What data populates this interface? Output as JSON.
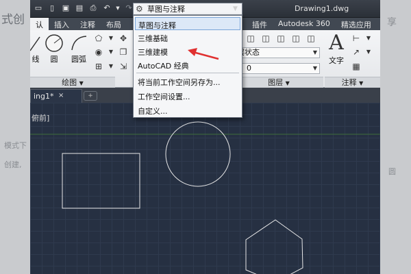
{
  "background_page": {
    "title_fragment": "式创",
    "line1_fragment": "模式下",
    "line2_fragment": "创建,",
    "right1_fragment": "享",
    "right2_fragment": "圆"
  },
  "titlebar": {
    "workspace_current": "草图与注释",
    "document_title": "Drawing1.dwg"
  },
  "ribbon_tabs": [
    {
      "label": "认"
    },
    {
      "label": "插入"
    },
    {
      "label": "注释"
    },
    {
      "label": "布局"
    },
    {
      "label": "插件"
    },
    {
      "label": "Autodesk 360"
    },
    {
      "label": "精选应用"
    }
  ],
  "ribbon": {
    "tool_line": "线",
    "tool_circle": "圆",
    "tool_arc": "圆弧",
    "panel_draw": "绘图",
    "layer_state": "层状态",
    "layer_current": "0",
    "panel_layers": "图层",
    "tool_text": "文字",
    "panel_annotation": "注释"
  },
  "file_tab": {
    "label": "ing1*",
    "close": "×"
  },
  "viewport_label": "俯前]",
  "workspace_menu": {
    "items": [
      {
        "label": "草图与注释",
        "selected": true
      },
      {
        "label": "三维基础",
        "selected": false
      },
      {
        "label": "三维建模",
        "selected": false
      },
      {
        "label": "AutoCAD 经典",
        "selected": false
      },
      {
        "label": "将当前工作空间另存为...",
        "selected": false
      },
      {
        "label": "工作空间设置...",
        "selected": false
      },
      {
        "label": "自定义...",
        "selected": false
      }
    ]
  },
  "colors": {
    "canvas": "#263042",
    "grid": "#2f3a4e",
    "annotation_arrow": "#e03030",
    "shape_stroke": "#e8e8e8",
    "ucs_line": "#3d6e3a"
  }
}
